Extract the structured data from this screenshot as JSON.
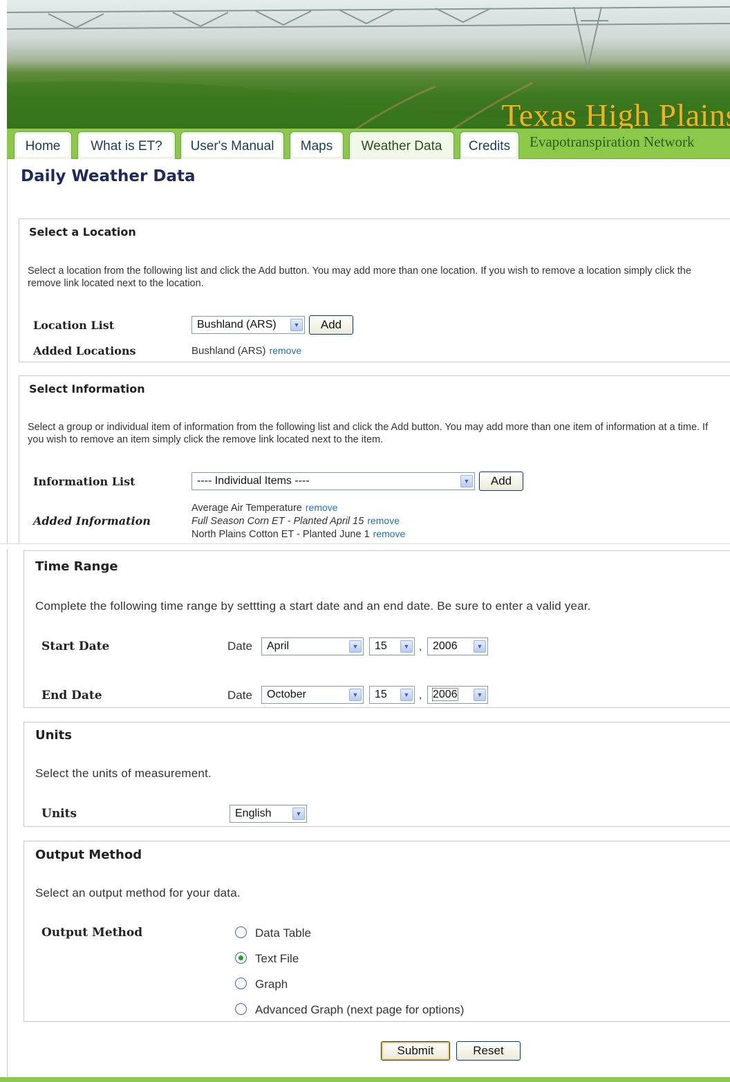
{
  "banner": {
    "title": "Texas High Plains",
    "subtitle": "Evapotranspiration Network"
  },
  "nav": {
    "tabs": [
      "Home",
      "What is ET?",
      "User's Manual",
      "Maps",
      "Weather Data",
      "Credits"
    ],
    "active": "Weather Data"
  },
  "page": {
    "title": "Daily Weather Data"
  },
  "location": {
    "heading": "Select a Location",
    "description": "Select a location from the following list and click the Add button. You may add more than one location. If you wish to remove a location simply click the remove link located next to the location.",
    "list_label": "Location List",
    "list_value": "Bushland (ARS)",
    "add_label": "Add",
    "added_label": "Added Locations",
    "added": [
      {
        "name": "Bushland (ARS)",
        "remove": "remove"
      }
    ]
  },
  "information": {
    "heading": "Select Information",
    "description": "Select a group or individual item of information from the following list and click the Add button. You may add more than one item of information at a time. If you wish to remove an item simply click the remove link located next to the item.",
    "list_label": "Information List",
    "list_value": "---- Individual Items ----",
    "add_label": "Add",
    "added_label": "Added Information",
    "added": [
      {
        "name": "Average Air Temperature",
        "remove": "remove"
      },
      {
        "name": "Full Season Corn ET - Planted April 15",
        "remove": "remove"
      },
      {
        "name": "North Plains Cotton ET - Planted June 1",
        "remove": "remove"
      }
    ]
  },
  "time_range": {
    "heading": "Time Range",
    "description": "Complete the following time range by settting a start date and an end date. Be sure to enter a valid year.",
    "date_word": "Date",
    "separator": ",",
    "start": {
      "label": "Start Date",
      "month": "April",
      "day": "15",
      "year": "2006"
    },
    "end": {
      "label": "End Date",
      "month": "October",
      "day": "15",
      "year": "2006"
    }
  },
  "units": {
    "heading": "Units",
    "description": "Select the units of measurement.",
    "label": "Units",
    "value": "English"
  },
  "output": {
    "heading": "Output Method",
    "description": "Select an output method for your data.",
    "label": "Output Method",
    "options": [
      "Data Table",
      "Text File",
      "Graph",
      "Advanced Graph (next page for options)"
    ],
    "selected": "Text File"
  },
  "buttons": {
    "submit": "Submit",
    "reset": "Reset"
  },
  "colors": {
    "nav_green": "#8cc94a",
    "title_gold": "#e3b820",
    "link_blue": "#1f6fb2",
    "heading_navy": "#1e2b5a"
  }
}
